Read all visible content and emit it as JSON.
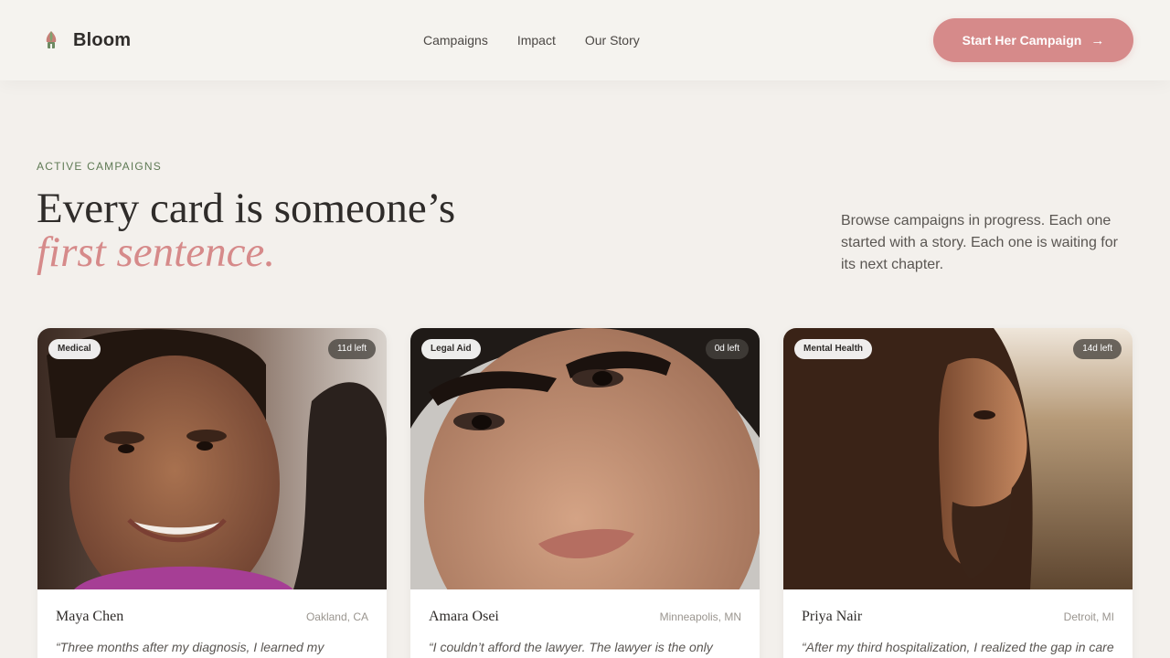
{
  "brand": {
    "name": "Bloom",
    "logo_icon": "flower-bud-icon",
    "colors": {
      "accent": "#d68a8a",
      "green": "#5f7a55",
      "background": "#f3f0ec"
    }
  },
  "nav": {
    "items": [
      "Campaigns",
      "Impact",
      "Our Story"
    ]
  },
  "cta": {
    "label": "Start Her Campaign",
    "icon": "arrow-right-icon",
    "arrow": "→"
  },
  "hero": {
    "eyebrow": "ACTIVE CAMPAIGNS",
    "headline_line1": "Every card is someone’s",
    "headline_accent": "first sentence.",
    "intro": "Browse campaigns in progress. Each one started with a story. Each one is waiting for its next chapter."
  },
  "campaigns": [
    {
      "category": "Medical",
      "days_left": "11d left",
      "name": "Maya Chen",
      "location": "Oakland, CA",
      "quote": "“Three months after my diagnosis, I learned my"
    },
    {
      "category": "Legal Aid",
      "days_left": "0d left",
      "name": "Amara Osei",
      "location": "Minneapolis, MN",
      "quote": "“I couldn’t afford the lawyer. The lawyer is the only"
    },
    {
      "category": "Mental Health",
      "days_left": "14d left",
      "name": "Priya Nair",
      "location": "Detroit, MI",
      "quote": "“After my third hospitalization, I realized the gap in care"
    }
  ]
}
